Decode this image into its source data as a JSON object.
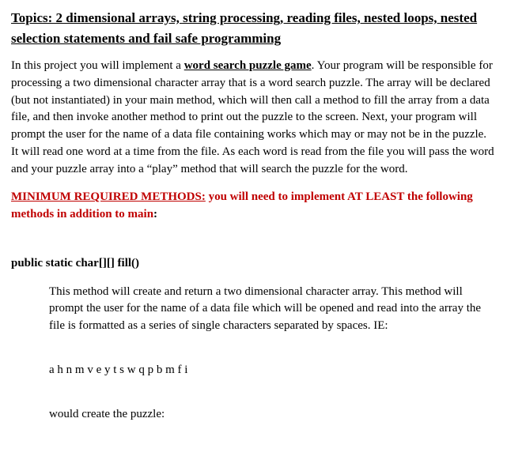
{
  "heading": "Topics:  2 dimensional arrays, string processing, reading files, nested loops, nested selection statements and fail safe programming",
  "intro": {
    "p1a": "In this project you will implement a ",
    "p1_bold": "word search puzzle game",
    "p1b": ".  Your program will be responsible for processing a two dimensional character array that is a word search puzzle.  The array will be declared (but not instantiated) in your main method,  which will then call a method to fill the array from a data file, and then invoke another method to print out the puzzle to the screen.  Next, your program will prompt the user for the name of a data file containing works which may or may not be in the puzzle.  It will read one word at a time from the file.  As each word is read from the file you will pass the word and your puzzle array into a “play” method that will search the puzzle for the word."
  },
  "req": {
    "label_u": "MINIMUM REQUIRED METHODS:",
    "text": "  you will need to implement AT LEAST the following methods in addition to main",
    "colon": ":"
  },
  "method1": {
    "signature": "public static char[][] fill()",
    "desc": "This method will create and return a two dimensional character array.  This method will prompt the user for the name of a data file which will be opened and read into the array the file is formatted as a series of single characters separated by spaces.  IE:",
    "example": "a h n m v e y t s w q p b m f i",
    "prelude": "would create the puzzle:"
  }
}
